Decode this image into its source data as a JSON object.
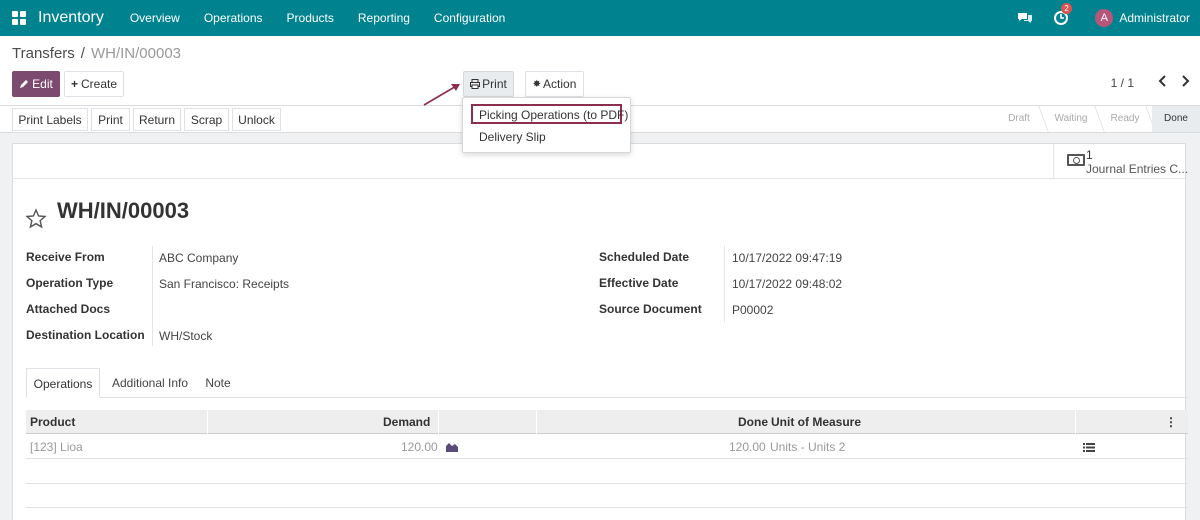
{
  "navbar": {
    "app_name": "Inventory",
    "menus": [
      "Overview",
      "Operations",
      "Products",
      "Reporting",
      "Configuration"
    ],
    "badge_count": "2",
    "avatar_letter": "A",
    "user_name": "Administrator",
    "color": "#00838f"
  },
  "breadcrumb": {
    "parent": "Transfers",
    "separator": "/",
    "current": "WH/IN/00003"
  },
  "control": {
    "edit_label": "Edit",
    "create_label": "Create",
    "print_label": "Print",
    "action_label": "Action",
    "pager": "1 / 1"
  },
  "print_menu": {
    "items": [
      "Picking Operations (to PDF)",
      "Delivery Slip"
    ]
  },
  "statusbar": {
    "buttons": [
      "Print Labels",
      "Print",
      "Return",
      "Scrap",
      "Unlock"
    ],
    "stages": [
      "Draft",
      "Waiting",
      "Ready",
      "Done"
    ],
    "active_stage": "Done"
  },
  "smart_button": {
    "value": "1",
    "label": "Journal Entries C..."
  },
  "record": {
    "title": "WH/IN/00003",
    "left_fields": [
      {
        "label": "Receive From",
        "value": "ABC Company"
      },
      {
        "label": "Operation Type",
        "value": "San Francisco: Receipts"
      },
      {
        "label": "Attached Docs",
        "value": ""
      },
      {
        "label": "Destination Location",
        "value": "WH/Stock"
      }
    ],
    "right_fields": [
      {
        "label": "Scheduled Date",
        "value": "10/17/2022 09:47:19"
      },
      {
        "label": "Effective Date",
        "value": "10/17/2022 09:48:02"
      },
      {
        "label": "Source Document",
        "value": "P00002"
      }
    ]
  },
  "tabs": [
    "Operations",
    "Additional Info",
    "Note"
  ],
  "table": {
    "headers": [
      "Product",
      "Demand",
      "Done",
      "Unit of Measure"
    ],
    "rows": [
      {
        "product": "[123] Lioa",
        "demand": "120.00",
        "done": "120.00",
        "uom": "Units - Units 2"
      }
    ]
  },
  "colors": {
    "primary": "#7c4a6e",
    "highlight": "#8c2e4d"
  }
}
